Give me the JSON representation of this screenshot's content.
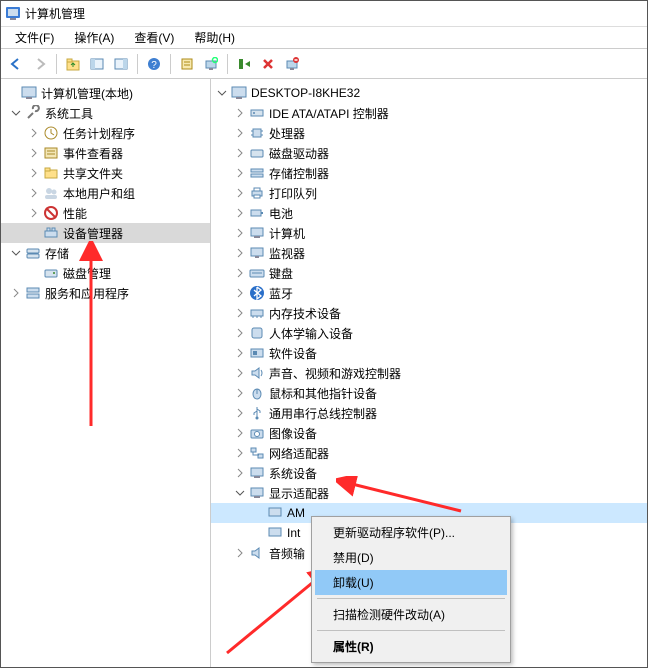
{
  "window": {
    "title": "计算机管理"
  },
  "menus": {
    "file": "文件(F)",
    "action": "操作(A)",
    "view": "查看(V)",
    "help": "帮助(H)"
  },
  "left_tree": {
    "root": "计算机管理(本地)",
    "system_tools": "系统工具",
    "task_scheduler": "任务计划程序",
    "event_viewer": "事件查看器",
    "shared_folders": "共享文件夹",
    "local_users": "本地用户和组",
    "performance": "性能",
    "device_manager": "设备管理器",
    "storage": "存储",
    "disk_management": "磁盘管理",
    "services_apps": "服务和应用程序"
  },
  "right_tree": {
    "root": "DESKTOP-I8KHE32",
    "ide": "IDE ATA/ATAPI 控制器",
    "cpu": "处理器",
    "disk_drives": "磁盘驱动器",
    "storage_controllers": "存储控制器",
    "print_queues": "打印队列",
    "batteries": "电池",
    "computer": "计算机",
    "monitors": "监视器",
    "keyboards": "键盘",
    "bluetooth": "蓝牙",
    "memory_devices": "内存技术设备",
    "hid": "人体学输入设备",
    "software_devices": "软件设备",
    "sound_video_game": "声音、视频和游戏控制器",
    "mice": "鼠标和其他指针设备",
    "usb": "通用串行总线控制器",
    "imaging": "图像设备",
    "network": "网络适配器",
    "system_devices": "系统设备",
    "display_adapters": "显示适配器",
    "gpu1_prefix": "AM",
    "gpu2_prefix": "Int",
    "audio_inputs_prefix": "音频输"
  },
  "context_menu": {
    "update_driver": "更新驱动程序软件(P)...",
    "disable": "禁用(D)",
    "uninstall": "卸载(U)",
    "scan_hardware": "扫描检测硬件改动(A)",
    "properties": "属性(R)"
  }
}
